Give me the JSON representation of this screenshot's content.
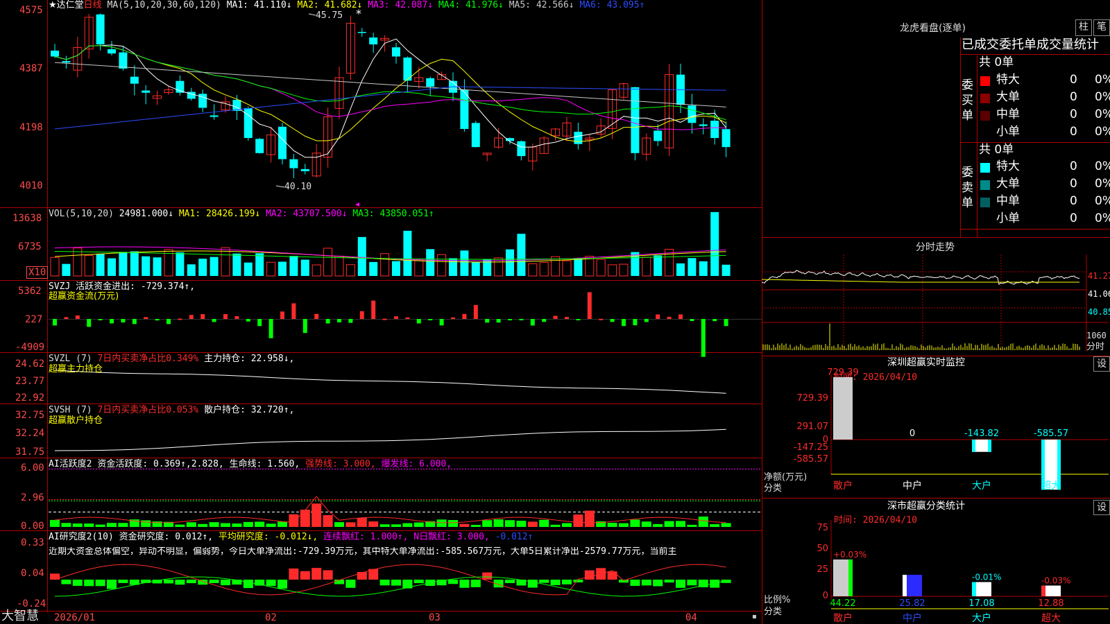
{
  "app": {
    "brand": "大智慧",
    "corner_glyph": "▪"
  },
  "colors": {
    "up": "#ff2b2b",
    "down": "#00ffff",
    "frame": "#b00000",
    "ma1": "#ffffff",
    "ma2": "#ffff00",
    "ma3": "#ff00ff",
    "ma4": "#00ff00",
    "ma5": "#c8c8c8",
    "ma6": "#2b4cff",
    "yellow": "#ffff00",
    "green": "#00ff00"
  },
  "kline": {
    "stock": "★达仁堂",
    "period": "日线",
    "ma_label": "MA(5,10,20,30,60,120)",
    "ma_items": [
      {
        "text": "MA1: 41.110↓",
        "color": "#ffffff"
      },
      {
        "text": "MA2: 41.682↓",
        "color": "#ffff00"
      },
      {
        "text": "MA3: 42.087↓",
        "color": "#ff00ff"
      },
      {
        "text": "MA4: 41.976↓",
        "color": "#00ff00"
      },
      {
        "text": "MA5: 42.566↓",
        "color": "#c8c8c8"
      },
      {
        "text": "MA6: 43.095↑",
        "color": "#2b4cff"
      }
    ],
    "y_labels": [
      "4575",
      "4387",
      "4198",
      "4010"
    ],
    "high_label": "45.75",
    "high_mark": "*",
    "low_label": "40.10",
    "x_labels": [
      "2026/01",
      "02",
      "03",
      "04"
    ]
  },
  "vol": {
    "label": "VOL(5,10,20)",
    "items": [
      {
        "text": "24981.000↓",
        "color": "#ffffff"
      },
      {
        "text": "MA1: 28426.199↓",
        "color": "#ffff00"
      },
      {
        "text": "MA2: 43707.500↓",
        "color": "#ff00ff"
      },
      {
        "text": "MA3: 43850.051↑",
        "color": "#00ff00"
      }
    ],
    "y_labels": [
      "13638",
      "6735"
    ],
    "unit": "X10"
  },
  "svzj": {
    "title": "SVZJ  活跃资金进出: -729.374↑,",
    "sub": "超赢资金流(万元)",
    "y_labels": [
      "5362",
      "227",
      "-4909"
    ]
  },
  "svzl": {
    "name": "SVZL (7)",
    "desc": "7日内买卖净占比0.349%",
    "value": "主力持仓: 22.958↓,",
    "sub": "超赢主力持仓",
    "y_labels": [
      "24.62",
      "23.77",
      "22.92"
    ]
  },
  "svsh": {
    "name": "SVSH (7)",
    "desc": "7日内买卖净占比0.053%",
    "value": "散户持仓: 32.720↑,",
    "sub": "超赢散户持仓",
    "y_labels": [
      "32.75",
      "32.24",
      "31.75"
    ]
  },
  "ai1": {
    "title": "AI活跃度2",
    "items": [
      {
        "text": "资金活跃度: 0.369↑,",
        "color": "#ffffff"
      },
      {
        "text": "2.828,",
        "color": "#ffffff"
      },
      {
        "text": "生命线: 1.560,",
        "color": "#ffffff"
      },
      {
        "text": "强势线: 3.000,",
        "color": "#ff2b2b"
      },
      {
        "text": "爆发线: 6.000,",
        "color": "#ff00ff"
      }
    ],
    "y_labels": [
      "6.00",
      "2.96",
      "0.00"
    ]
  },
  "ai2": {
    "title": "AI研究度2(10)",
    "items": [
      {
        "text": "资金研究度: 0.012↑,",
        "color": "#ffffff"
      },
      {
        "text": "平均研究度: -0.012↓,",
        "color": "#ffff00"
      },
      {
        "text": "连续飘红: 1.000↑,",
        "color": "#ff00ff"
      },
      {
        "text": "N日飘红: 3.000,",
        "color": "#ff00ff"
      },
      {
        "text": "-0.012↑",
        "color": "#2b4cff"
      }
    ],
    "comment": "近期大资金总体偏空，异动不明显，偏弱势，今日大单净流出:-729.39万元，其中特大单净流出:-585.567万元，大单5日累计净出-2579.77万元，当前主",
    "y_labels": [
      "0.33",
      "0.04",
      "-0.24"
    ]
  },
  "lhb": {
    "title": "龙虎看盘(逐单)",
    "btn1": "柱",
    "btn2": "笔",
    "header": "已成交委托单成交量统计",
    "buy": {
      "label": "委买单",
      "total": "共 0单",
      "rows": [
        {
          "name": "特大",
          "v": "0",
          "p": "0%",
          "c": "#ff0000"
        },
        {
          "name": "大单",
          "v": "0",
          "p": "0%",
          "c": "#8b0000"
        },
        {
          "name": "中单",
          "v": "0",
          "p": "0%",
          "c": "#5a0000"
        },
        {
          "name": "小单",
          "v": "0",
          "p": "0%",
          "c": ""
        }
      ]
    },
    "sell": {
      "label": "委卖单",
      "total": "共 0单",
      "rows": [
        {
          "name": "特大",
          "v": "0",
          "p": "0%",
          "c": "#00ffff"
        },
        {
          "name": "大单",
          "v": "0",
          "p": "0%",
          "c": "#008b8b"
        },
        {
          "name": "中单",
          "v": "0",
          "p": "0%",
          "c": "#006060"
        },
        {
          "name": "小单",
          "v": "0",
          "p": "0%",
          "c": ""
        }
      ]
    }
  },
  "fenshi": {
    "title": "分时走势",
    "y_labels": [
      "41.27",
      "41.06",
      "40.85"
    ],
    "vol_label": "1060",
    "mode_label": "分时"
  },
  "monitor": {
    "title": "深圳超赢实时监控",
    "btn": "设",
    "time": "时间: 2026/04/10",
    "y_labels": [
      "729.39",
      "291.07",
      "0",
      "-147.25",
      "-585.57"
    ],
    "net_label": "净额(万元)",
    "cat_label": "分类",
    "categories": [
      {
        "name": "散户",
        "value": 729.39,
        "label": "729.39"
      },
      {
        "name": "中户",
        "value": 0,
        "label": "0"
      },
      {
        "name": "大户",
        "value": -143.82,
        "label": "-143.82"
      },
      {
        "name": "超大",
        "value": -585.57,
        "label": "-585.57"
      }
    ]
  },
  "classify": {
    "title": "深市超赢分类统计",
    "btn": "设",
    "time": "时间: 2026/04/10",
    "y_labels": [
      "75",
      "50",
      "25",
      "0"
    ],
    "ratio_label": "比例%",
    "cat_label": "分类",
    "categories": [
      {
        "name": "散户",
        "value": 44.22,
        "label": "44.22",
        "delta": "+0.03%"
      },
      {
        "name": "中户",
        "value": 25.82,
        "label": "25.82",
        "delta": ""
      },
      {
        "name": "大户",
        "value": 17.08,
        "label": "17.08",
        "delta": "-0.01%"
      },
      {
        "name": "超大",
        "value": 12.88,
        "label": "12.88",
        "delta": "-0.03%"
      }
    ]
  }
}
